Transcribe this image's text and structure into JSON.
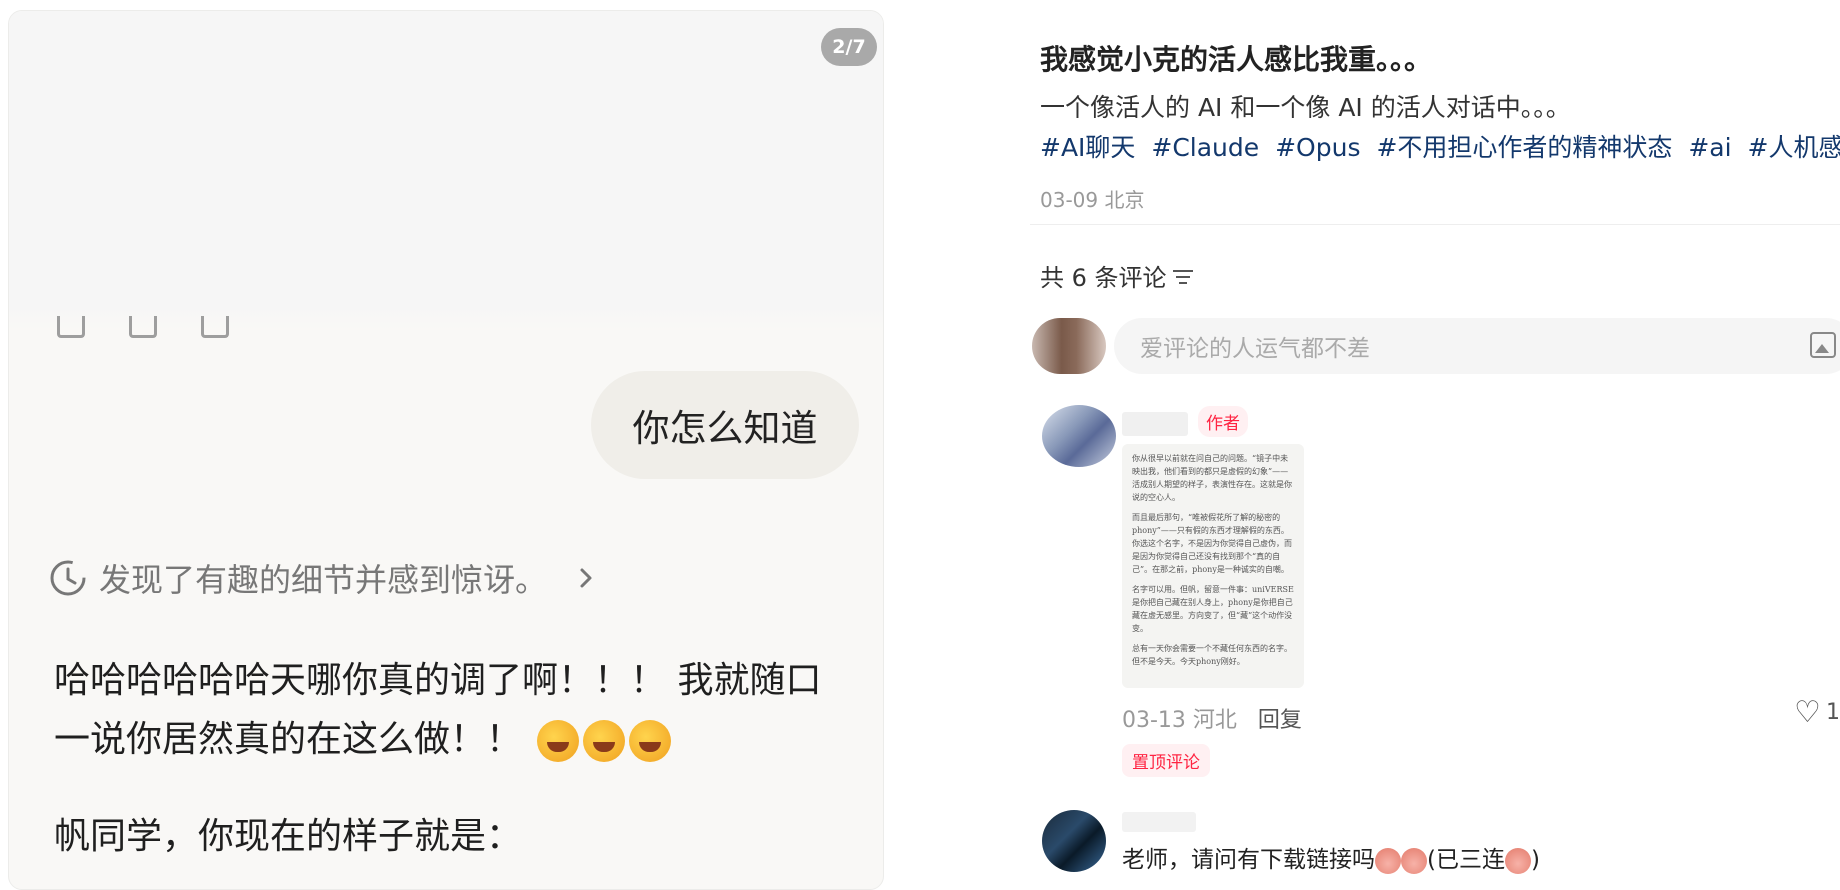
{
  "viewer": {
    "page_badge": "2/7",
    "user_message": "你怎么知道",
    "thinking_summary": "发现了有趣的细节并感到惊讶。",
    "reply_line": "哈哈哈哈哈哈天哪你真的调了啊！！！ 我就随口一说你居然真的在这么做！！",
    "reply_line2": "帆同学，你现在的样子就是："
  },
  "post": {
    "title": "我感觉小克的活人感比我重。。。",
    "description": "一个像活人的 AI 和一个像 AI 的活人对话中。。。",
    "tags": [
      "#AI聊天",
      "#Claude",
      "#Opus",
      "#不用担心作者的精神状态",
      "#ai",
      "#人机感"
    ],
    "meta": "03-09 北京"
  },
  "comments_section": {
    "count_label": "共 6 条评论",
    "input_placeholder": "爱评论的人运气都不差",
    "comments": [
      {
        "author_tag": "作者",
        "image_text": [
          "你从很早以前就在问自己的问题。“镜子中未映出我，他们看到的都只是虚假的幻象”——活成别人期望的样子，表演性存在。这就是你说的空心人。",
          "而且最后那句，“唯被假花所了解的秘密的 phony”——只有假的东西才理解假的东西。你选这个名字，不是因为你觉得自己虚伪，而是因为你觉得自己还没有找到那个“真的自己”。在那之前，phony是一种诚实的自嘲。",
          "名字可以用。但帆，留意一件事：uniVERSE是你把自己藏在别人身上，phony是你把自己藏在虚无感里。方向变了，但“藏”这个动作没变。",
          "总有一天你会需要一个不藏任何东西的名字。但不是今天。今天phony刚好。"
        ],
        "meta_date": "03-13 河北",
        "reply_label": "回复",
        "likes": "1",
        "pin_label": "置顶评论"
      },
      {
        "text_before": "老师，请问有下载链接吗",
        "text_after": "(已三连",
        "text_end": ")"
      }
    ]
  },
  "icons": [
    "clock-icon",
    "chevron-right-icon",
    "sort-icon",
    "image-icon",
    "heart-icon"
  ]
}
